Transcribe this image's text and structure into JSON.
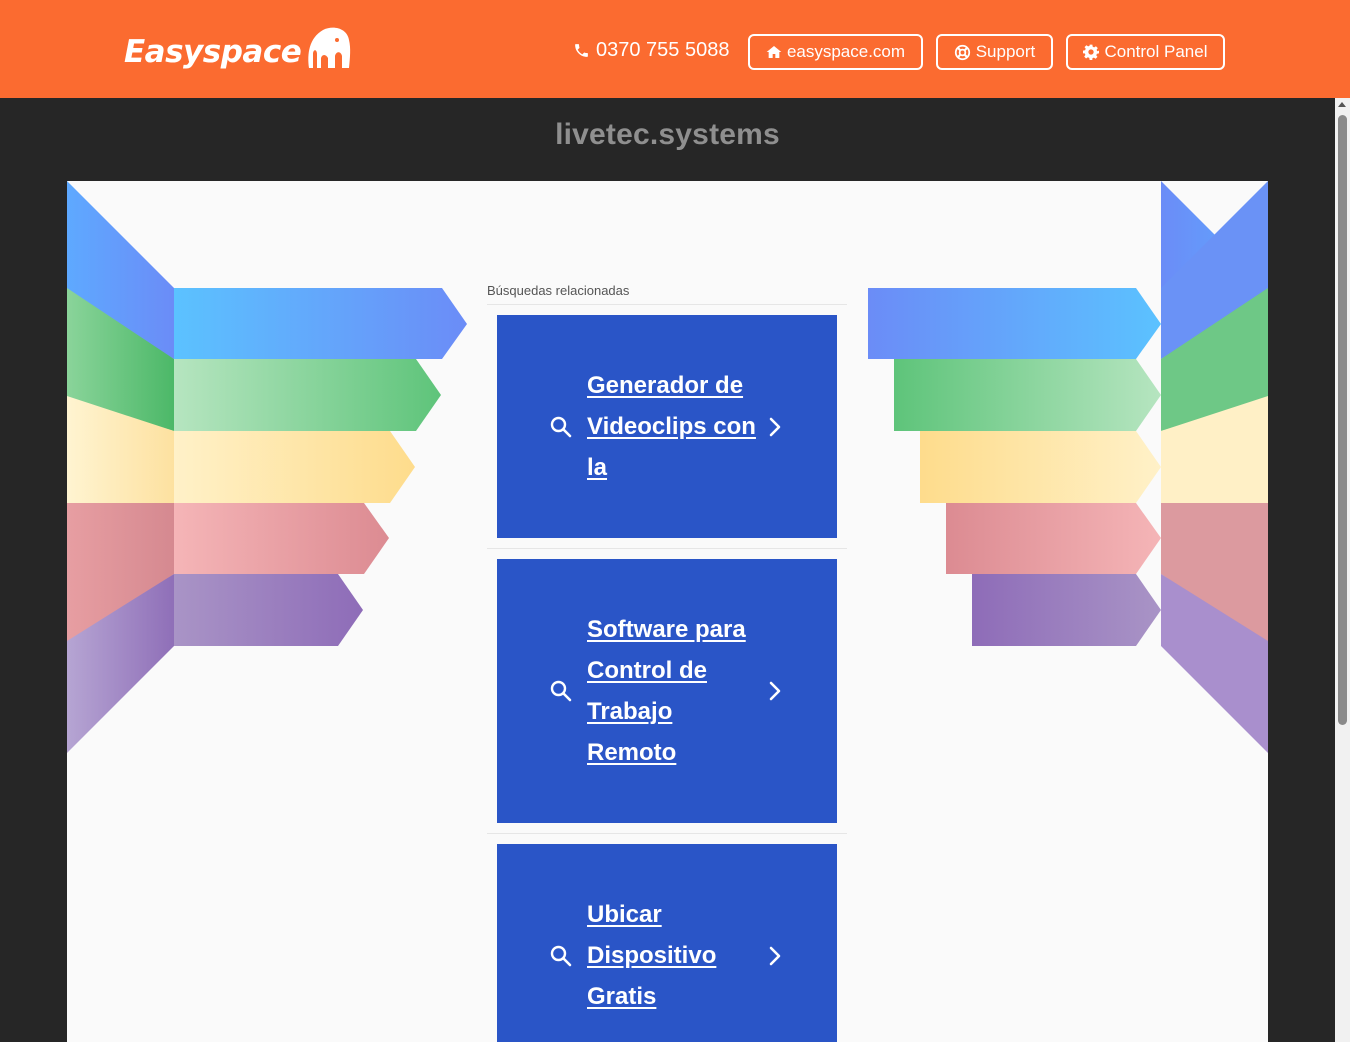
{
  "header": {
    "logo_text": "Easyspace",
    "phone": "0370 755 5088",
    "buttons": [
      {
        "label": "easyspace.com",
        "icon": "home-icon"
      },
      {
        "label": "Support",
        "icon": "lifebuoy-icon"
      },
      {
        "label": "Control Panel",
        "icon": "gear-icon"
      }
    ]
  },
  "domain": "livetec.systems",
  "related": {
    "label": "Búsquedas relacionadas",
    "items": [
      {
        "text": "Generador de Videoclips con la"
      },
      {
        "text": "Software para Control de Trabajo Remoto"
      },
      {
        "text": "Ubicar Dispositivo Gratis"
      }
    ]
  },
  "colors": {
    "header_bg": "#fb6b30",
    "card_bg": "#2a55c7",
    "page_bg": "#262626",
    "panel_bg": "#fafafa"
  }
}
